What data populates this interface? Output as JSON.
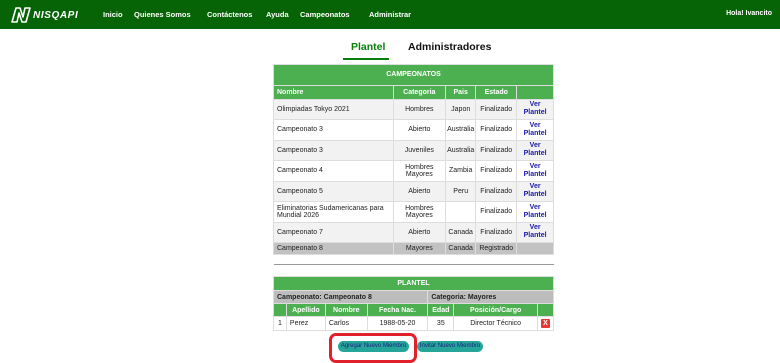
{
  "brand": {
    "name": "NISQAPI"
  },
  "nav": {
    "items": [
      {
        "label": "Inicio"
      },
      {
        "label": "Quienes Somos"
      },
      {
        "label": "Contáctenos"
      },
      {
        "label": "Ayuda"
      },
      {
        "label": "Campeonatos"
      },
      {
        "label": "Administrar"
      }
    ],
    "greeting": "Hola! Ivancito"
  },
  "tabs": {
    "active": "Plantel",
    "other": "Administradores"
  },
  "campeonatos": {
    "caption": "CAMPEONATOS",
    "headers": [
      "Nombre",
      "Categoria",
      "Pais",
      "Estado",
      ""
    ],
    "rows": [
      {
        "nombre": "Olimpiadas Tokyo 2021",
        "categoria": "Hombres",
        "pais": "Japon",
        "estado": "Finalizado",
        "accion": "Ver Plantel"
      },
      {
        "nombre": "Campeonato 3",
        "categoria": "Abierto",
        "pais": "Australia",
        "estado": "Finalizado",
        "accion": "Ver Plantel"
      },
      {
        "nombre": "Campeonato 3",
        "categoria": "Juveniles",
        "pais": "Australia",
        "estado": "Finalizado",
        "accion": "Ver Plantel"
      },
      {
        "nombre": "Campeonato 4",
        "categoria": "Hombres Mayores",
        "pais": "Zambia",
        "estado": "Finalizado",
        "accion": "Ver Plantel"
      },
      {
        "nombre": "Campeonato 5",
        "categoria": "Abierto",
        "pais": "Peru",
        "estado": "Finalizado",
        "accion": "Ver Plantel"
      },
      {
        "nombre": "Eliminatorias Sudamericanas para Mundial 2026",
        "categoria": "Hombres Mayores",
        "pais": "",
        "estado": "Finalizado",
        "accion": "Ver Plantel"
      },
      {
        "nombre": "Campeonato 7",
        "categoria": "Abierto",
        "pais": "Canada",
        "estado": "Finalizado",
        "accion": "Ver Plantel"
      },
      {
        "nombre": "Campeonato 8",
        "categoria": "Mayores",
        "pais": "Canada",
        "estado": "Registrado",
        "accion": ""
      }
    ]
  },
  "plantel": {
    "caption": "PLANTEL",
    "campeonato_label": "Campeonato: Campeonato 8",
    "categoria_label": "Categoria: Mayores",
    "headers": [
      "",
      "Apellido",
      "Nombre",
      "Fecha Nac.",
      "Edad",
      "Posición/Cargo",
      ""
    ],
    "members": [
      {
        "num": "1",
        "apellido": "Perez",
        "nombre": "Carlos",
        "fecha": "1988-05-20",
        "edad": "35",
        "cargo": "Director Técnico",
        "delete": "X"
      }
    ]
  },
  "buttons": {
    "agregar": "Agregar Nuevo Miembro",
    "invitar": "Invitar Nuevo Miembro"
  },
  "colors": {
    "header_green": "#066406",
    "table_green": "#4caf50",
    "button_teal": "#26a69a",
    "highlight_red": "#e0202a"
  }
}
